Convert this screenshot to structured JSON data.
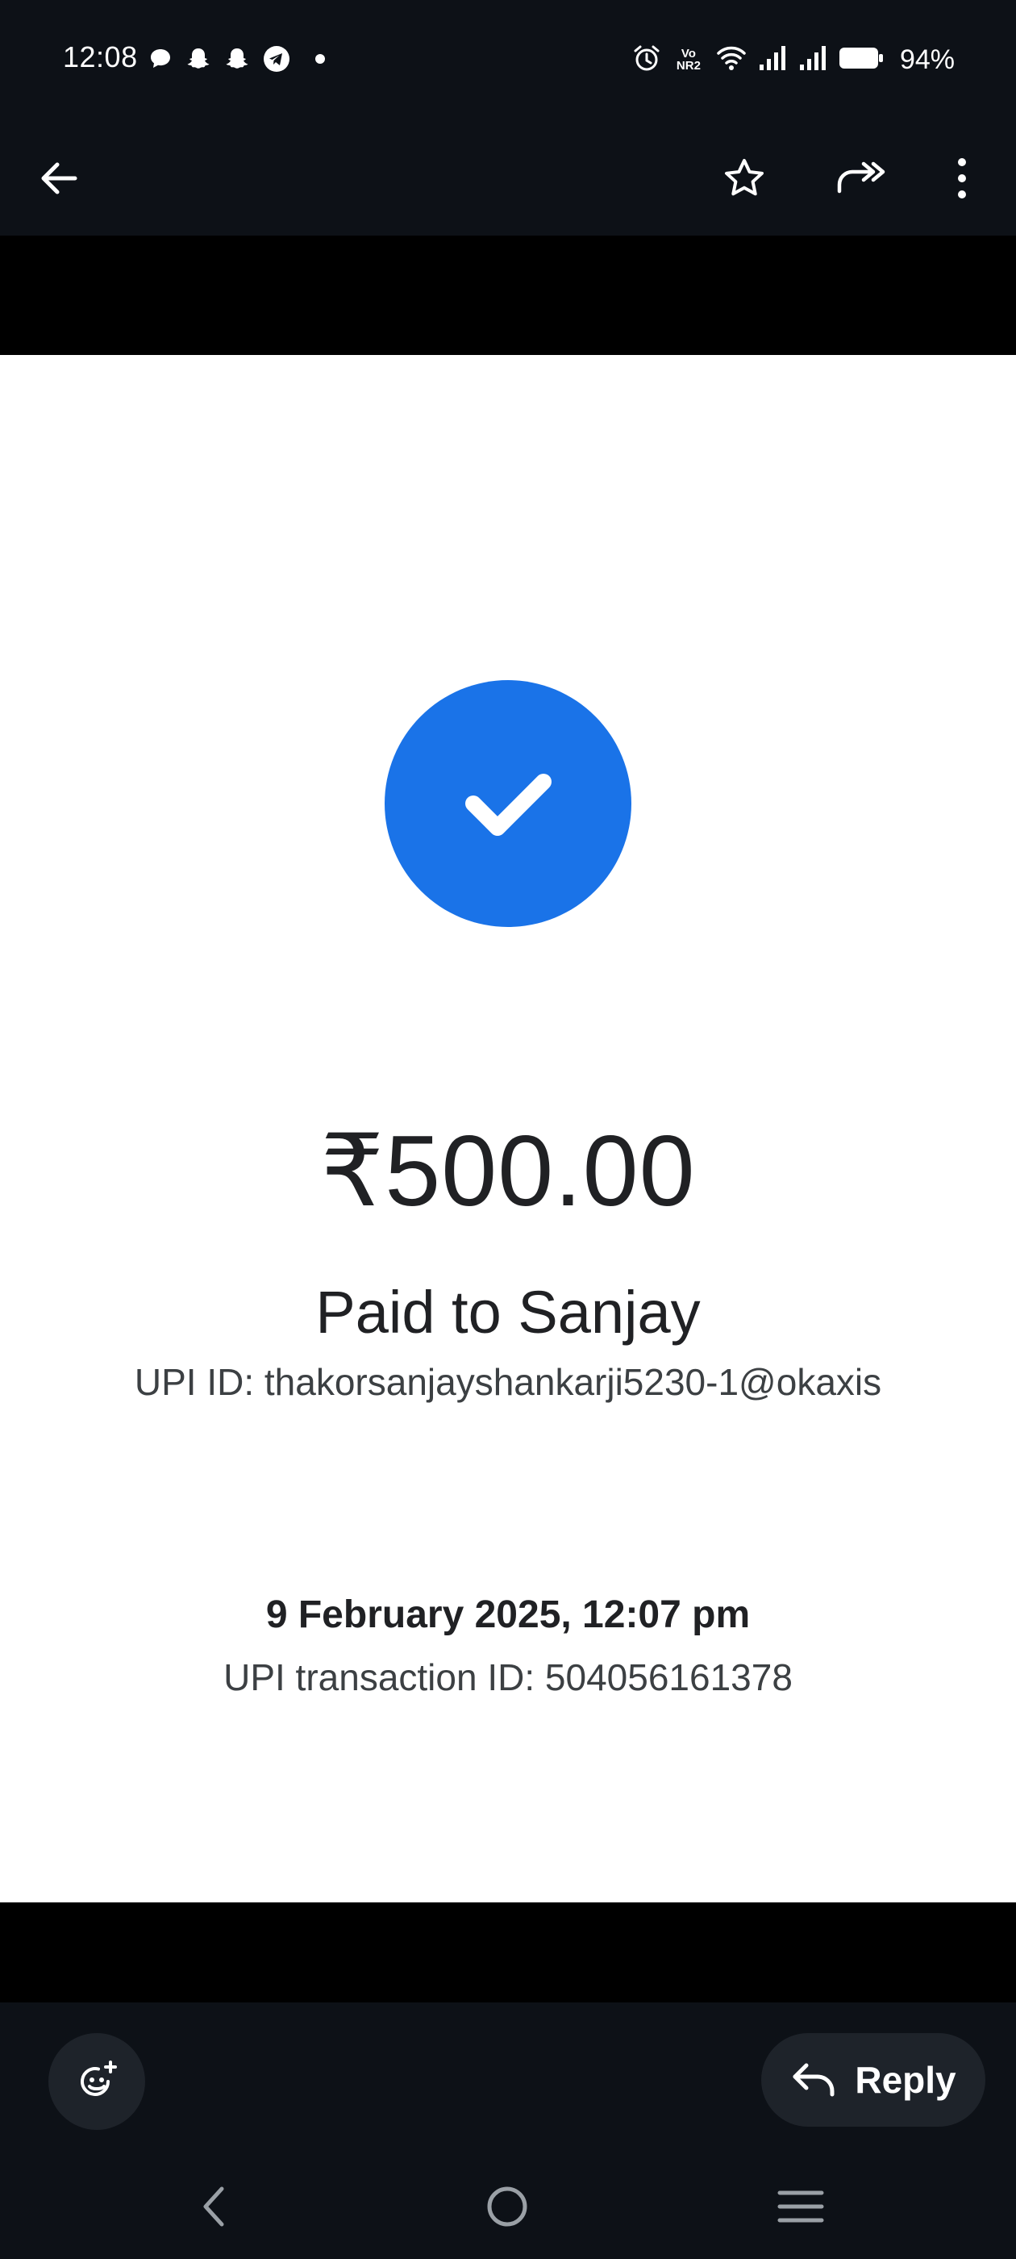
{
  "status_bar": {
    "time": "12:08",
    "network_label": "Vo NR2",
    "battery_percent": "94%",
    "notification_icons": [
      "chat-bubble-icon",
      "snapchat-icon",
      "snapchat-icon",
      "telegram-icon",
      "more-dot-icon"
    ]
  },
  "app_bar": {
    "icons": [
      "back-arrow-icon",
      "star-icon",
      "forward-icon",
      "more-vert-icon"
    ]
  },
  "receipt": {
    "amount": "₹500.00",
    "payee": "Paid to Sanjay",
    "upi_id": "UPI ID: thakorsanjayshankarji5230-1@okaxis",
    "date_time": "9 February 2025, 12:07 pm",
    "transaction_id": "UPI transaction ID: 504056161378",
    "accent_color": "#1a73e8"
  },
  "bottom_bar": {
    "reply_label": "Reply"
  }
}
